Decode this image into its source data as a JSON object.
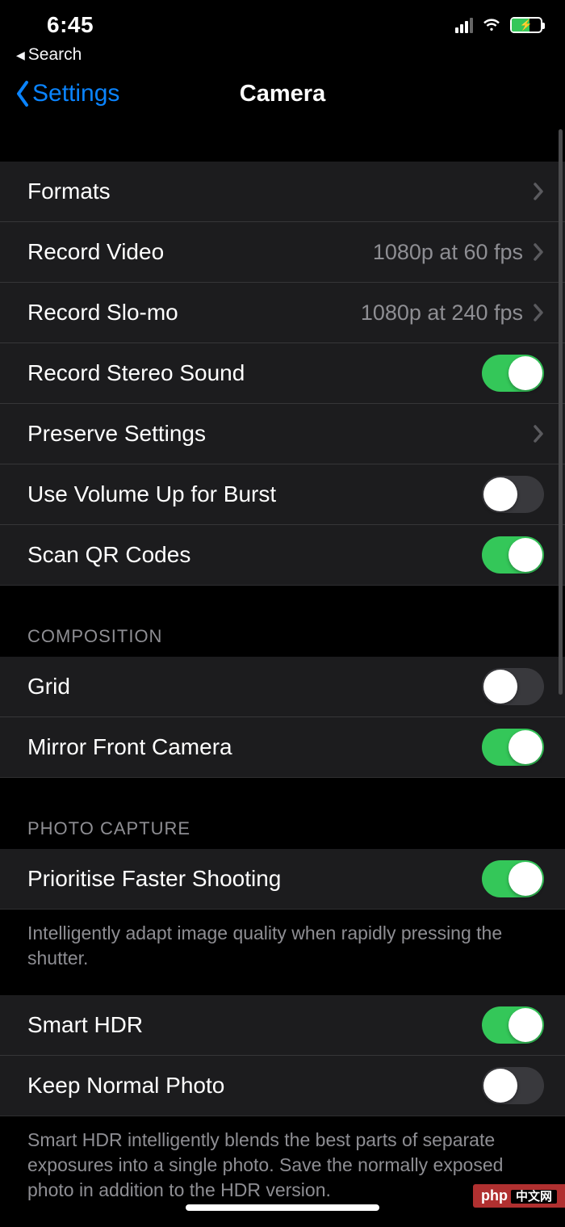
{
  "status": {
    "time": "6:45"
  },
  "breadcrumb": {
    "label": "Search"
  },
  "nav": {
    "back_label": "Settings",
    "title": "Camera"
  },
  "section1": {
    "rows": [
      {
        "label": "Formats",
        "value": "",
        "kind": "chevron"
      },
      {
        "label": "Record Video",
        "value": "1080p at 60 fps",
        "kind": "chevron"
      },
      {
        "label": "Record Slo-mo",
        "value": "1080p at 240 fps",
        "kind": "chevron"
      },
      {
        "label": "Record Stereo Sound",
        "kind": "toggle",
        "on": true
      },
      {
        "label": "Preserve Settings",
        "value": "",
        "kind": "chevron"
      },
      {
        "label": "Use Volume Up for Burst",
        "kind": "toggle",
        "on": false
      },
      {
        "label": "Scan QR Codes",
        "kind": "toggle",
        "on": true
      }
    ]
  },
  "section2": {
    "header": "COMPOSITION",
    "rows": [
      {
        "label": "Grid",
        "kind": "toggle",
        "on": false
      },
      {
        "label": "Mirror Front Camera",
        "kind": "toggle",
        "on": true
      }
    ]
  },
  "section3": {
    "header": "PHOTO CAPTURE",
    "rows": [
      {
        "label": "Prioritise Faster Shooting",
        "kind": "toggle",
        "on": true
      }
    ],
    "footer": "Intelligently adapt image quality when rapidly pressing the shutter."
  },
  "section4": {
    "rows": [
      {
        "label": "Smart HDR",
        "kind": "toggle",
        "on": true
      },
      {
        "label": "Keep Normal Photo",
        "kind": "toggle",
        "on": false
      }
    ],
    "footer": "Smart HDR intelligently blends the best parts of separate exposures into a single photo. Save the normally exposed photo in addition to the HDR version."
  },
  "watermark": {
    "text": "php",
    "box": "中文网"
  }
}
